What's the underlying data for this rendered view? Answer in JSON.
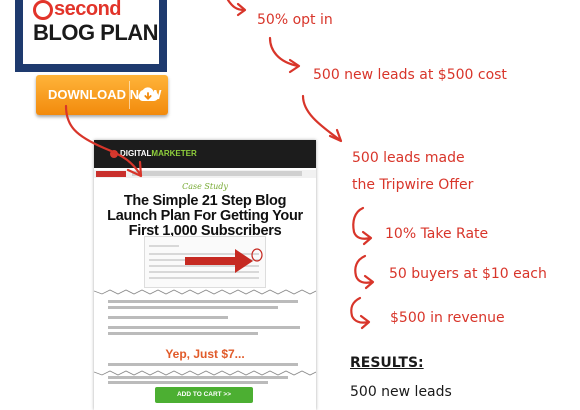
{
  "card": {
    "title_top": "second",
    "title_main": "BLOG PLAN"
  },
  "download_button": {
    "label": "DOWNLOAD NOW",
    "icon": "cloud-download-icon"
  },
  "sales_page": {
    "logo_prefix": "DIGITAL",
    "logo_suffix": "MARKETER",
    "case_study": "Case Study",
    "headline": "The Simple 21 Step Blog Launch Plan For Getting Your First 1,000 Subscribers",
    "yep": "Yep, Just $7...",
    "add_to_cart": "ADD TO CART >>"
  },
  "funnel_steps": [
    "50% opt in",
    "500 new leads at $500 cost",
    "500 leads made",
    "the Tripwire Offer",
    "10% Take Rate",
    "50 buyers at $10 each",
    "$500 in revenue"
  ],
  "results": {
    "title": "RESULTS:",
    "lines": [
      "500 new leads"
    ]
  },
  "colors": {
    "accent_red": "#d8352a",
    "button_orange": "#f28a0c",
    "card_navy": "#1e3a6e",
    "cart_green": "#4caf32"
  }
}
